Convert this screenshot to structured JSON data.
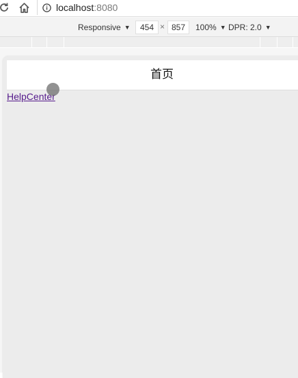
{
  "browser": {
    "url_host": "localhost",
    "url_port": ":8080",
    "icons": {
      "reload": "reload-icon",
      "home": "home-icon",
      "info": "info-icon"
    }
  },
  "device_toolbar": {
    "mode": "Responsive",
    "width": "454",
    "times": "×",
    "height": "857",
    "zoom": "100%",
    "dpr": "DPR: 2.0"
  },
  "app": {
    "title": "首页",
    "link": "HelpCenter",
    "colors": {
      "link": "#551a8b",
      "content_bg": "#ececec"
    }
  }
}
